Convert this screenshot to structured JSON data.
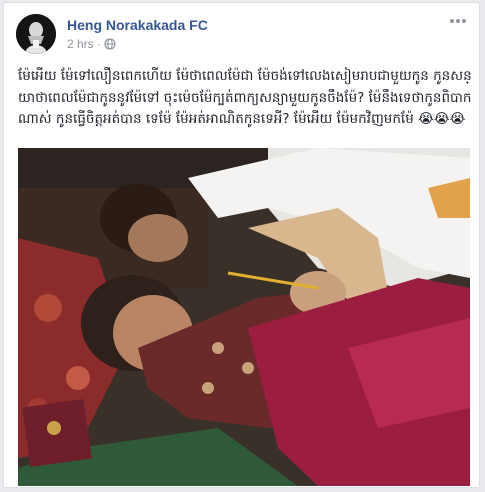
{
  "post": {
    "author": "Heng Norakakada FC",
    "timestamp": "2 hrs",
    "separator": "·",
    "privacy_icon": "globe-icon",
    "more_icon": "more-options-icon",
    "text": "ម៉ែអើយ ម៉ែទៅលឿនពេកហើយ ម៉ែថាពេលម៉ែជា ម៉ែចង់ទៅលេងសៀមរាបជាមួយកូន កូនសន្យាថាពេលម៉ែជាកូននូវម៉ែទៅ ចុះម៉េចម៉ែក្បត់ពាក្យសន្យាមួយកូនចឹងម៉ែ? ម៉ែនឹងទេថាកូនពិបាកណាស់ កូនធ្វើចិត្តអត់បាន ទេម៉ែ ម៉ែអត់អាណិតកូនទេអី? ម៉ែអើយ ម៉ែមកវិញមកម៉ែ",
    "emoji": "😭😭😭",
    "photo_description_icon": "post-photo"
  },
  "colors": {
    "author_link": "#365899",
    "meta_text": "#90949c",
    "body_text": "#1d2129",
    "card_border": "#dddfe2",
    "page_bg": "#e9ebee"
  }
}
